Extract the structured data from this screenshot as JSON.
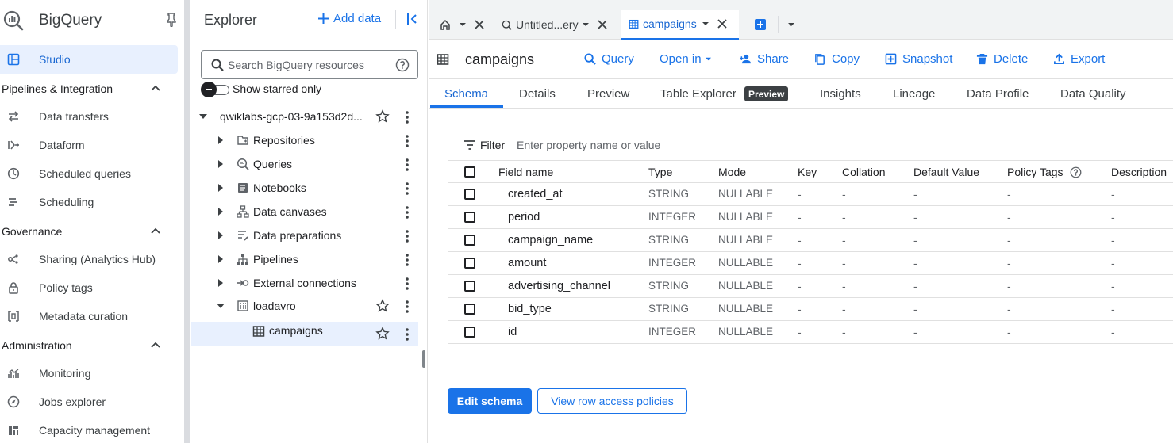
{
  "app": {
    "title": "BigQuery"
  },
  "nav": {
    "studio": "Studio",
    "sections": {
      "pipelines": "Pipelines & Integration",
      "governance": "Governance",
      "administration": "Administration"
    },
    "items": {
      "data_transfers": "Data transfers",
      "dataform": "Dataform",
      "scheduled_queries": "Scheduled queries",
      "scheduling": "Scheduling",
      "sharing": "Sharing (Analytics Hub)",
      "policy_tags": "Policy tags",
      "metadata_curation": "Metadata curation",
      "monitoring": "Monitoring",
      "jobs_explorer": "Jobs explorer",
      "capacity_management": "Capacity management"
    }
  },
  "explorer": {
    "title": "Explorer",
    "add_data": "Add data",
    "search_placeholder": "Search BigQuery resources",
    "show_starred": "Show starred only",
    "project": "qwiklabs-gcp-03-9a153d2d...",
    "children": {
      "repositories": "Repositories",
      "queries": "Queries",
      "notebooks": "Notebooks",
      "data_canvases": "Data canvases",
      "data_preparations": "Data preparations",
      "pipelines": "Pipelines",
      "external_connections": "External connections",
      "dataset": "loadavro",
      "table": "campaigns"
    }
  },
  "tabs": {
    "untitled": "Untitled...ery",
    "campaigns": "campaigns"
  },
  "toolbar": {
    "title": "campaigns",
    "query": "Query",
    "open_in": "Open in",
    "share": "Share",
    "copy": "Copy",
    "snapshot": "Snapshot",
    "delete": "Delete",
    "export": "Export"
  },
  "subtabs": {
    "schema": "Schema",
    "details": "Details",
    "preview": "Preview",
    "table_explorer": "Table Explorer",
    "preview_badge": "Preview",
    "insights": "Insights",
    "lineage": "Lineage",
    "data_profile": "Data Profile",
    "data_quality": "Data Quality"
  },
  "filter": {
    "label": "Filter",
    "placeholder": "Enter property name or value"
  },
  "schema": {
    "headers": {
      "field_name": "Field name",
      "type": "Type",
      "mode": "Mode",
      "key": "Key",
      "collation": "Collation",
      "default_value": "Default Value",
      "policy_tags": "Policy Tags",
      "description": "Description"
    },
    "rows": [
      {
        "name": "created_at",
        "type": "STRING",
        "mode": "NULLABLE",
        "key": "-",
        "collation": "-",
        "default": "-",
        "policy": "-",
        "desc": "-"
      },
      {
        "name": "period",
        "type": "INTEGER",
        "mode": "NULLABLE",
        "key": "-",
        "collation": "-",
        "default": "-",
        "policy": "-",
        "desc": "-"
      },
      {
        "name": "campaign_name",
        "type": "STRING",
        "mode": "NULLABLE",
        "key": "-",
        "collation": "-",
        "default": "-",
        "policy": "-",
        "desc": "-"
      },
      {
        "name": "amount",
        "type": "INTEGER",
        "mode": "NULLABLE",
        "key": "-",
        "collation": "-",
        "default": "-",
        "policy": "-",
        "desc": "-"
      },
      {
        "name": "advertising_channel",
        "type": "STRING",
        "mode": "NULLABLE",
        "key": "-",
        "collation": "-",
        "default": "-",
        "policy": "-",
        "desc": "-"
      },
      {
        "name": "bid_type",
        "type": "STRING",
        "mode": "NULLABLE",
        "key": "-",
        "collation": "-",
        "default": "-",
        "policy": "-",
        "desc": "-"
      },
      {
        "name": "id",
        "type": "INTEGER",
        "mode": "NULLABLE",
        "key": "-",
        "collation": "-",
        "default": "-",
        "policy": "-",
        "desc": "-"
      }
    ]
  },
  "actions": {
    "edit_schema": "Edit schema",
    "row_access": "View row access policies"
  },
  "colors": {
    "accent": "#1a73e8",
    "active_bg": "#e8f0fe",
    "text": "#202124"
  },
  "icons": [
    "bigquery-logo",
    "pin-icon",
    "studio-icon",
    "home-icon",
    "search-icon",
    "table-icon",
    "star-icon",
    "more-vert-icon"
  ]
}
